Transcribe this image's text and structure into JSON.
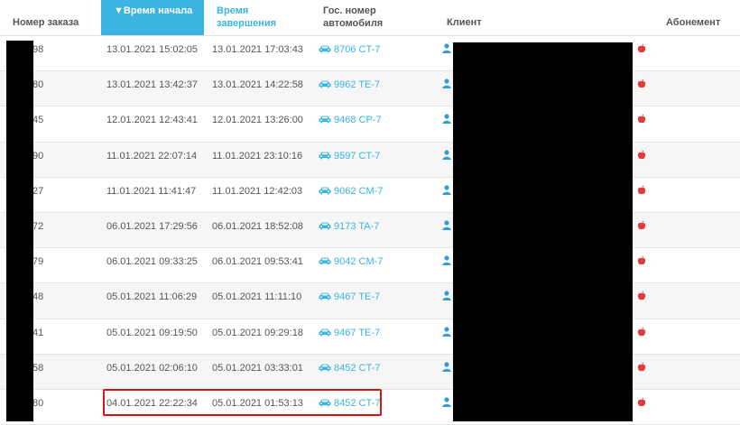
{
  "colors": {
    "accent": "#3ab4e0",
    "client_icon": "#2f9ed6",
    "apple_icon": "#e23b3b",
    "highlight": "#d81414"
  },
  "header": {
    "order_number": "Номер заказа",
    "start_time": "▼Время начала",
    "end_time": "Время завершения",
    "plate": "Гос. номер автомобиля",
    "client": "Клиент",
    "subscription": "Абонемент"
  },
  "icons": {
    "plate": "car-icon",
    "client": "person-icon",
    "subscription": "apple-icon"
  },
  "rows": [
    {
      "order_tail": "98",
      "start": "13.01.2021 15:02:05",
      "end": "13.01.2021 17:03:43",
      "plate": "8706 CT-7"
    },
    {
      "order_tail": "80",
      "start": "13.01.2021 13:42:37",
      "end": "13.01.2021 14:22:58",
      "plate": "9962 TE-7"
    },
    {
      "order_tail": "45",
      "start": "12.01.2021 12:43:41",
      "end": "12.01.2021 13:26:00",
      "plate": "9468 CP-7"
    },
    {
      "order_tail": "90",
      "start": "11.01.2021 22:07:14",
      "end": "11.01.2021 23:10:16",
      "plate": "9597 CT-7"
    },
    {
      "order_tail": "27",
      "start": "11.01.2021 11:41:47",
      "end": "11.01.2021 12:42:03",
      "plate": "9062 CM-7"
    },
    {
      "order_tail": "72",
      "start": "06.01.2021 17:29:56",
      "end": "06.01.2021 18:52:08",
      "plate": "9173 TA-7"
    },
    {
      "order_tail": "79",
      "start": "06.01.2021 09:33:25",
      "end": "06.01.2021 09:53:41",
      "plate": "9042 CM-7"
    },
    {
      "order_tail": "48",
      "start": "05.01.2021 11:06:29",
      "end": "05.01.2021 11:11:10",
      "plate": "9467 TE-7"
    },
    {
      "order_tail": "41",
      "start": "05.01.2021 09:19:50",
      "end": "05.01.2021 09:29:18",
      "plate": "9467 TE-7"
    },
    {
      "order_tail": "58",
      "start": "05.01.2021 02:06:10",
      "end": "05.01.2021 03:33:01",
      "plate": "8452 CT-7"
    },
    {
      "order_tail": "80",
      "start": "04.01.2021 22:22:34",
      "end": "05.01.2021 01:53:13",
      "plate": "8452 CT-7"
    }
  ]
}
